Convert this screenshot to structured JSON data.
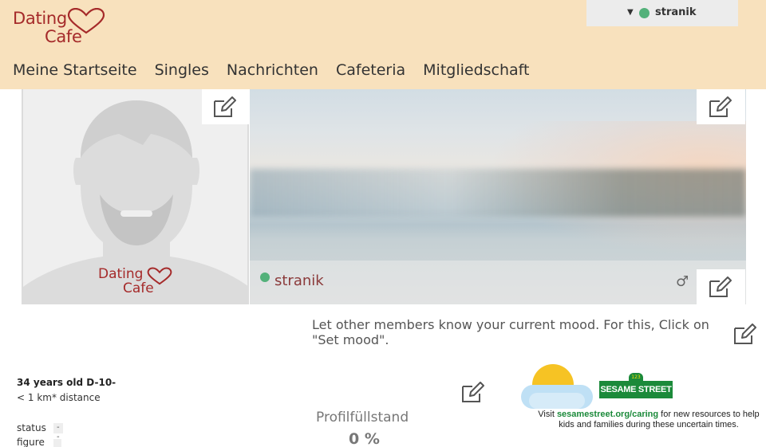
{
  "header": {
    "logo_line1": "Dating",
    "logo_line2": "Cafe",
    "user": {
      "username": "stranik",
      "status_color": "#53b17a"
    },
    "nav": [
      {
        "label": "Meine Startseite"
      },
      {
        "label": "Singles"
      },
      {
        "label": "Nachrichten"
      },
      {
        "label": "Cafeteria"
      },
      {
        "label": "Mitgliedschaft"
      }
    ]
  },
  "profile": {
    "name": "stranik",
    "online_color": "#53b17a",
    "gender_icon": "♂",
    "avatar_logo_line1": "Dating",
    "avatar_logo_line2": "Cafe",
    "mood_text": "Let other members know your current mood. For this, Click on \"Set mood\".",
    "age_line": "34 years old D-10-",
    "distance_line": "< 1 km* distance",
    "attributes": [
      {
        "label": "status",
        "value": "---"
      },
      {
        "label": "figure",
        "value": ""
      }
    ],
    "fill_label": "Profilfüllstand",
    "fill_value": "0 %"
  },
  "ad": {
    "logo_text": "SESAME STREET",
    "badge_text": "123",
    "text_before": "Visit ",
    "link_text": "sesamestreet.org/caring",
    "text_after": " for new resources to help kids and families during these uncertain times."
  },
  "colors": {
    "header_bg": "#f8e1bd",
    "brand": "#a52a2a",
    "online": "#53b17a"
  },
  "icons": {
    "edit": "edit-icon",
    "caret": "caret-down-icon",
    "gender": "male-icon"
  }
}
